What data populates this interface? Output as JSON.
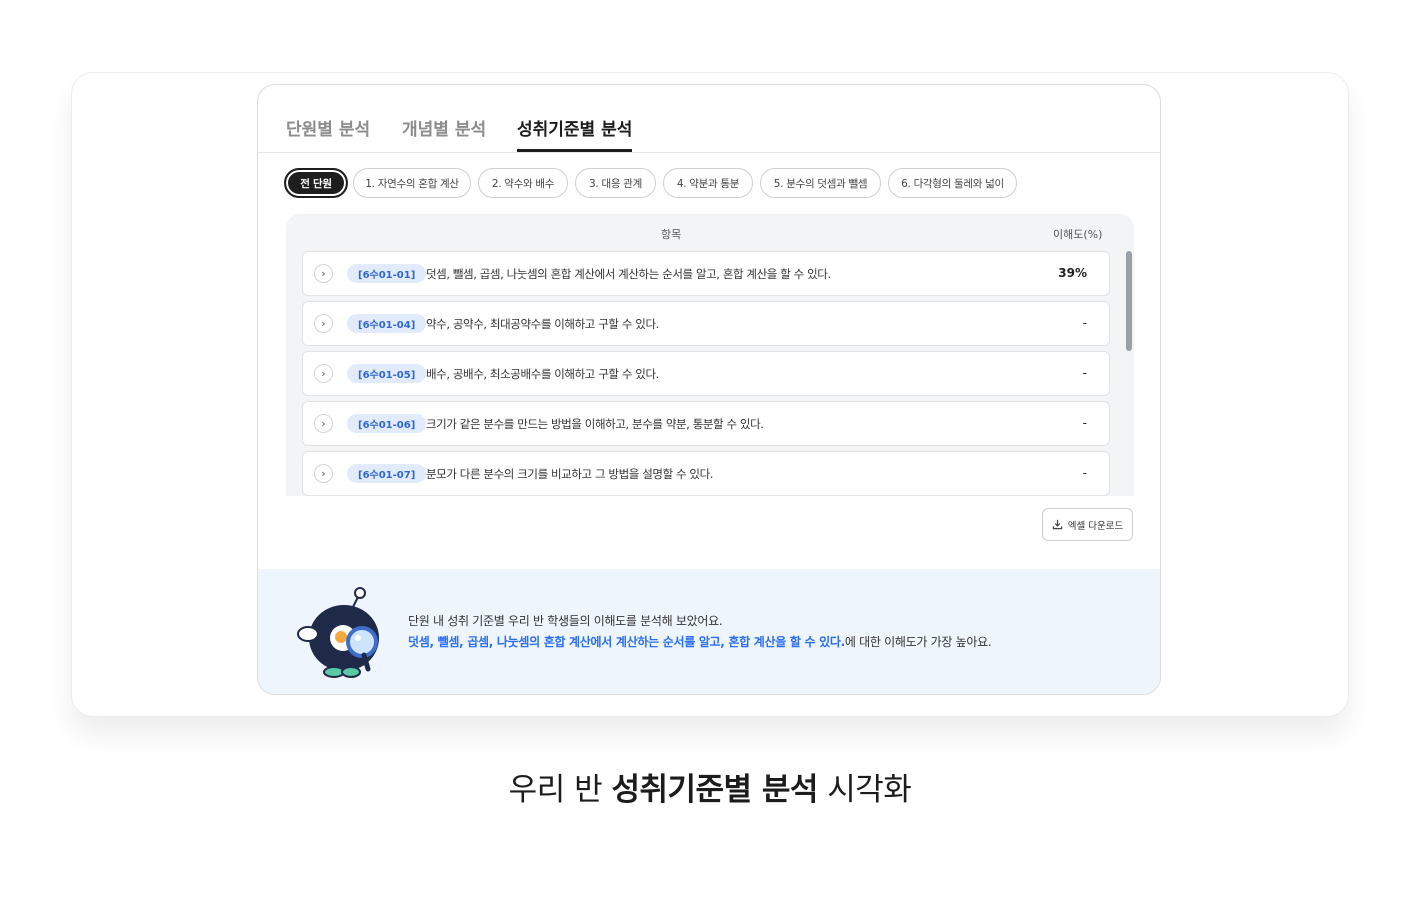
{
  "tabs": [
    {
      "label": "단원별 분석",
      "active": false
    },
    {
      "label": "개념별 분석",
      "active": false
    },
    {
      "label": "성취기준별 분석",
      "active": true
    }
  ],
  "chips": [
    {
      "label": "전 단원",
      "active": true
    },
    {
      "label": "1. 자연수의 혼합 계산"
    },
    {
      "label": "2. 약수와 배수"
    },
    {
      "label": "3. 대응 관계"
    },
    {
      "label": "4. 약분과 통분"
    },
    {
      "label": "5. 분수의 덧셈과 뺄셈"
    },
    {
      "label": "6. 다각형의 둘레와 넓이"
    }
  ],
  "table": {
    "header_item": "항목",
    "header_score": "이해도(%)",
    "rows": [
      {
        "code": "[6수01-01]",
        "desc": "덧셈, 뺄셈, 곱셈, 나눗셈의 혼합 계산에서 계산하는 순서를 알고, 혼합 계산을 할 수 있다.",
        "score": "39%"
      },
      {
        "code": "[6수01-04]",
        "desc": "약수, 공약수, 최대공약수를 이해하고 구할 수 있다.",
        "score": "-"
      },
      {
        "code": "[6수01-05]",
        "desc": "배수, 공배수, 최소공배수를 이해하고 구할 수 있다.",
        "score": "-"
      },
      {
        "code": "[6수01-06]",
        "desc": "크기가 같은 분수를 만드는 방법을 이해하고, 분수를 약분, 통분할 수 있다.",
        "score": "-"
      },
      {
        "code": "[6수01-07]",
        "desc": "분모가 다른 분수의 크기를 비교하고 그 방법을 설명할 수 있다.",
        "score": "-"
      }
    ]
  },
  "excel_button": "엑셀 다운로드",
  "summary": {
    "line1": "단원 내 성취 기준별 우리 반 학생들의 이해도를 분석해 보았어요.",
    "highlight": "덧셈, 뺄셈, 곱셈, 나눗셈의 혼합 계산에서 계산하는 순서를 알고, 혼합 계산을 할 수 있다.",
    "suffix": "에 대한 이해도가 가장 높아요."
  },
  "caption": {
    "prefix": "우리 반 ",
    "bold": "성취기준별 분석",
    "suffix": " 시각화"
  },
  "colors": {
    "accent": "#2a6ef2",
    "code_bg": "#e2ebfb",
    "summary_bg": "#eef5fc"
  }
}
